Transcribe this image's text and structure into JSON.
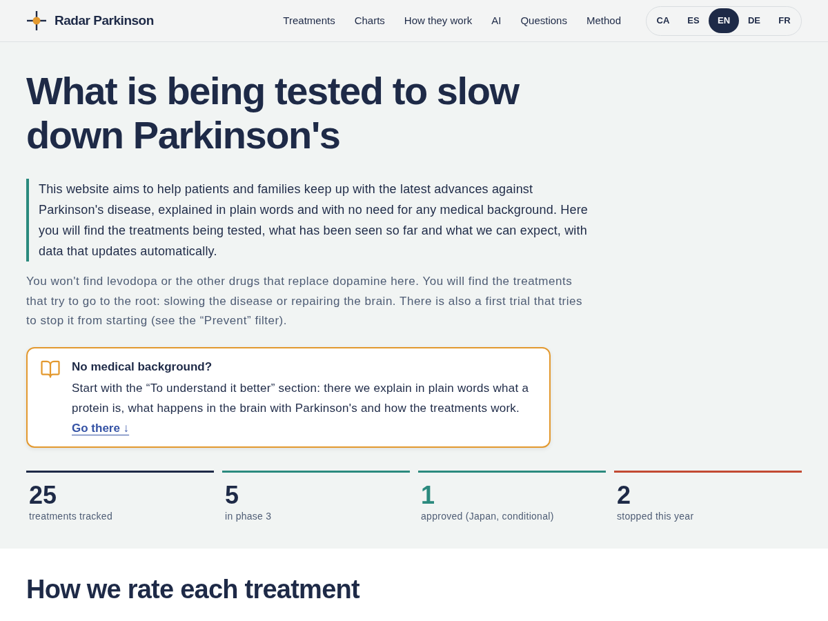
{
  "header": {
    "brand": "Radar Parkinson",
    "nav": [
      "Treatments",
      "Charts",
      "How they work",
      "AI",
      "Questions",
      "Method"
    ],
    "languages": [
      {
        "label": "CA",
        "selected": false
      },
      {
        "label": "ES",
        "selected": false
      },
      {
        "label": "EN",
        "selected": true
      },
      {
        "label": "DE",
        "selected": false
      },
      {
        "label": "FR",
        "selected": false
      }
    ]
  },
  "hero": {
    "title": "What is being tested to slow down Parkinson's",
    "intro": "This website aims to help patients and families keep up with the latest advances against Parkinson's disease, explained in plain words and with no need for any medical background. Here you will find the treatments being tested, what has been seen so far and what we can expect, with data that updates automatically.",
    "note": "You won't find levodopa or the other drugs that replace dopamine here. You will find the treatments that try to go to the root: slowing the disease or repairing the brain. There is also a first trial that tries to stop it from starting (see the “Prevent” filter).",
    "callout": {
      "title": "No medical background?",
      "text": "Start with the “To understand it better” section: there we explain in plain words what a protein is, what happens in the brain with Parkinson's and how the treatments work.",
      "link": "Go there ↓"
    }
  },
  "stats": [
    {
      "value": "25",
      "label": "treatments tracked",
      "color": "#1e2a47",
      "accent_value": false
    },
    {
      "value": "5",
      "label": "in phase 3",
      "color": "#2b8a7e",
      "accent_value": false
    },
    {
      "value": "1",
      "label": "approved (Japan, conditional)",
      "color": "#2b8a7e",
      "accent_value": true
    },
    {
      "value": "2",
      "label": "stopped this year",
      "color": "#c24a33",
      "accent_value": false
    }
  ],
  "section": {
    "title": "How we rate each treatment"
  }
}
